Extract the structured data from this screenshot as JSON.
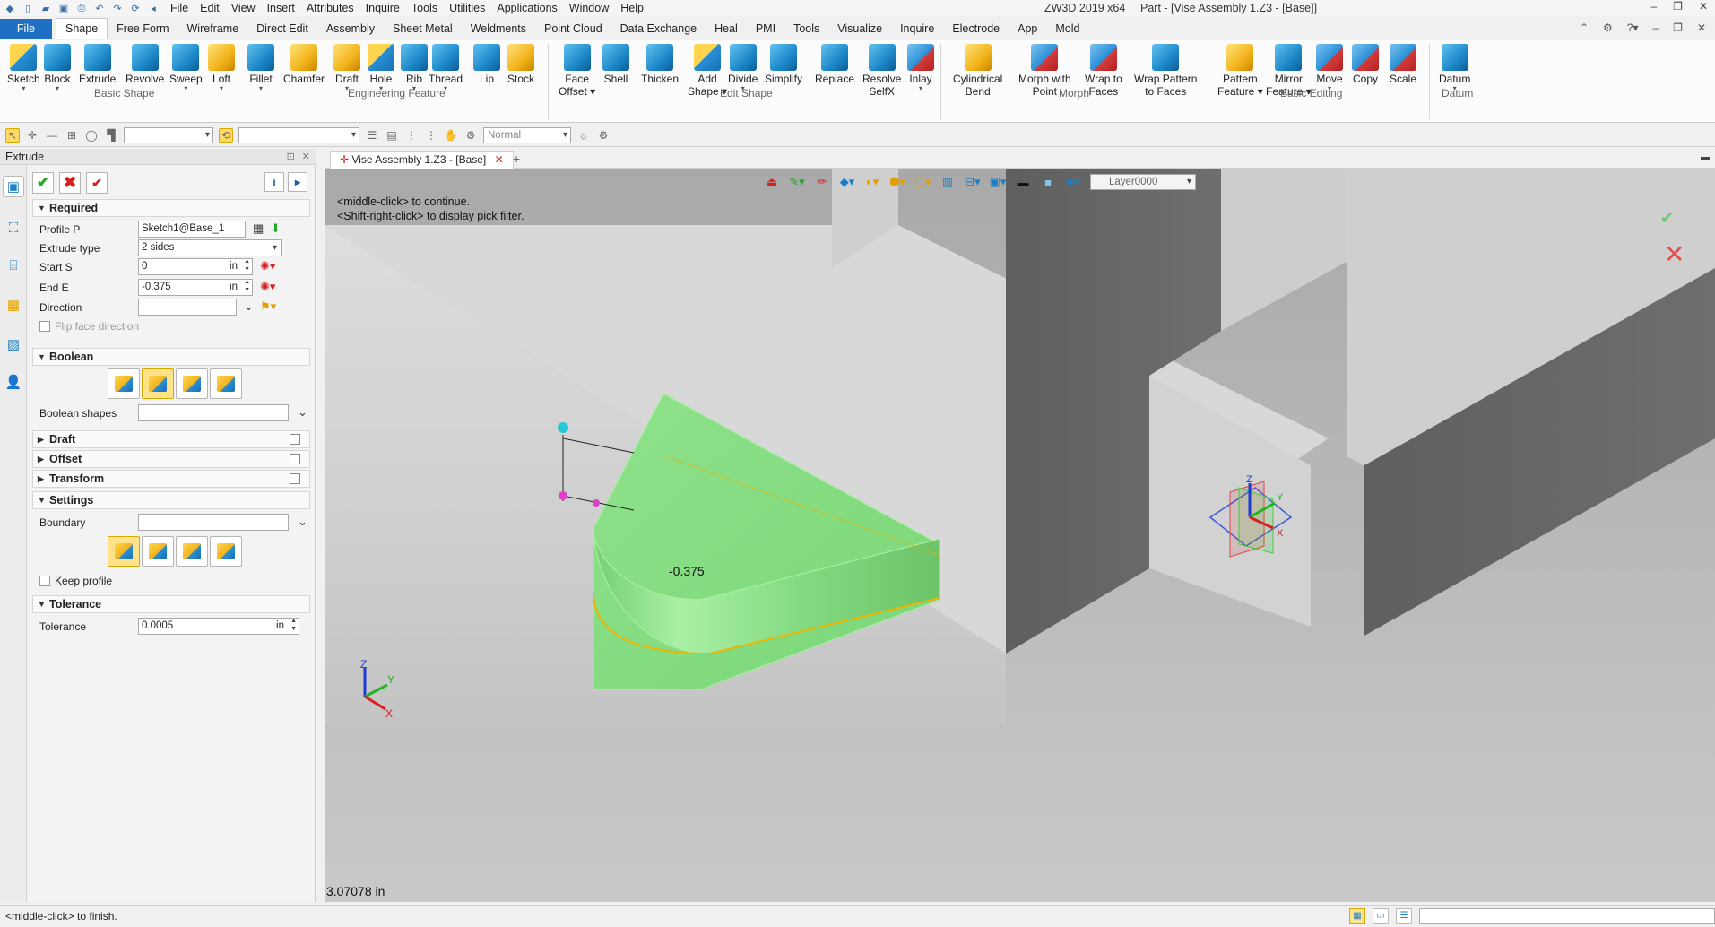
{
  "titlebar": {
    "menu": [
      "File",
      "Edit",
      "View",
      "Insert",
      "Attributes",
      "Inquire",
      "Tools",
      "Utilities",
      "Applications",
      "Window",
      "Help"
    ],
    "app_name": "ZW3D 2019  x64",
    "window_title": "Part - [Vise Assembly 1.Z3 - [Base]]"
  },
  "ribbon_tabs": [
    "File",
    "Shape",
    "Free Form",
    "Wireframe",
    "Direct Edit",
    "Assembly",
    "Sheet Metal",
    "Weldments",
    "Point Cloud",
    "Data Exchange",
    "Heal",
    "PMI",
    "Tools",
    "Visualize",
    "Inquire",
    "Electrode",
    "App",
    "Mold"
  ],
  "ribbon": {
    "buttons": [
      {
        "label": "Sketch",
        "sub": "▾"
      },
      {
        "label": "Block",
        "sub": "▾"
      },
      {
        "label": "Extrude",
        "sub": ""
      },
      {
        "label": "Revolve",
        "sub": ""
      },
      {
        "label": "Sweep",
        "sub": "▾"
      },
      {
        "label": "Loft",
        "sub": "▾"
      },
      {
        "label": "Fillet",
        "sub": "▾"
      },
      {
        "label": "Chamfer",
        "sub": ""
      },
      {
        "label": "Draft",
        "sub": "▾"
      },
      {
        "label": "Hole",
        "sub": "▾"
      },
      {
        "label": "Rib",
        "sub": "▾"
      },
      {
        "label": "Thread",
        "sub": "▾"
      },
      {
        "label": "Lip",
        "sub": ""
      },
      {
        "label": "Stock",
        "sub": ""
      },
      {
        "label": "Face",
        "sub": "Offset ▾"
      },
      {
        "label": "Shell",
        "sub": ""
      },
      {
        "label": "Thicken",
        "sub": ""
      },
      {
        "label": "Add",
        "sub": "Shape ▾"
      },
      {
        "label": "Divide",
        "sub": "▾"
      },
      {
        "label": "Simplify",
        "sub": ""
      },
      {
        "label": "Replace",
        "sub": ""
      },
      {
        "label": "Resolve",
        "sub": "SelfX"
      },
      {
        "label": "Inlay",
        "sub": "▾"
      },
      {
        "label": "Cylindrical",
        "sub": "Bend"
      },
      {
        "label": "Morph with",
        "sub": "Point"
      },
      {
        "label": "Wrap to",
        "sub": "Faces"
      },
      {
        "label": "Wrap Pattern",
        "sub": "to Faces"
      },
      {
        "label": "Pattern",
        "sub": "Feature ▾"
      },
      {
        "label": "Mirror",
        "sub": "Feature ▾"
      },
      {
        "label": "Move",
        "sub": "▾"
      },
      {
        "label": "Copy",
        "sub": ""
      },
      {
        "label": "Scale",
        "sub": ""
      },
      {
        "label": "Datum",
        "sub": "▾"
      }
    ],
    "groups": [
      "Basic Shape",
      "Engineering Feature",
      "Edit Shape",
      "Morph",
      "Basic Editing",
      "Datum"
    ]
  },
  "toolbar2": {
    "render_mode": "Normal"
  },
  "panel": {
    "title": "Extrude",
    "sections": {
      "required": "Required",
      "boolean": "Boolean",
      "draft": "Draft",
      "offset": "Offset",
      "transform": "Transform",
      "settings": "Settings",
      "tolerance": "Tolerance"
    },
    "fields": {
      "profile_label": "Profile P",
      "profile_value": "Sketch1@Base_1",
      "extrude_type_label": "Extrude type",
      "extrude_type_value": "2 sides",
      "start_label": "Start S",
      "start_value": "0",
      "start_unit": "in",
      "end_label": "End E",
      "end_value": "-0.375",
      "end_unit": "in",
      "direction_label": "Direction",
      "direction_value": "",
      "flip_label": "Flip face direction",
      "boolean_shapes_label": "Boolean shapes",
      "boundary_label": "Boundary",
      "keep_profile_label": "Keep profile",
      "tolerance_label": "Tolerance",
      "tolerance_value": "0.0005",
      "tolerance_unit": "in"
    }
  },
  "document": {
    "tab_label": "Vise Assembly 1.Z3 - [Base]",
    "tab_close": "✕",
    "tab_add": "+"
  },
  "viewport": {
    "prompt_line1": "<middle-click> to continue.",
    "prompt_line2": "<Shift-right-click> to display pick filter.",
    "layer": "Layer0000",
    "dimension_label": "-0.375",
    "coord_readout": "3.07078 in",
    "axis_z": "Z",
    "axis_y": "Y",
    "axis_x": "X"
  },
  "statusbar": {
    "message": "<middle-click> to finish."
  },
  "colors": {
    "accent": "#1f6fc4",
    "preview_green": "#8ee08a",
    "profile_edge": "#f0b400",
    "ok_green": "#26a626",
    "cancel_red": "#d42020"
  }
}
